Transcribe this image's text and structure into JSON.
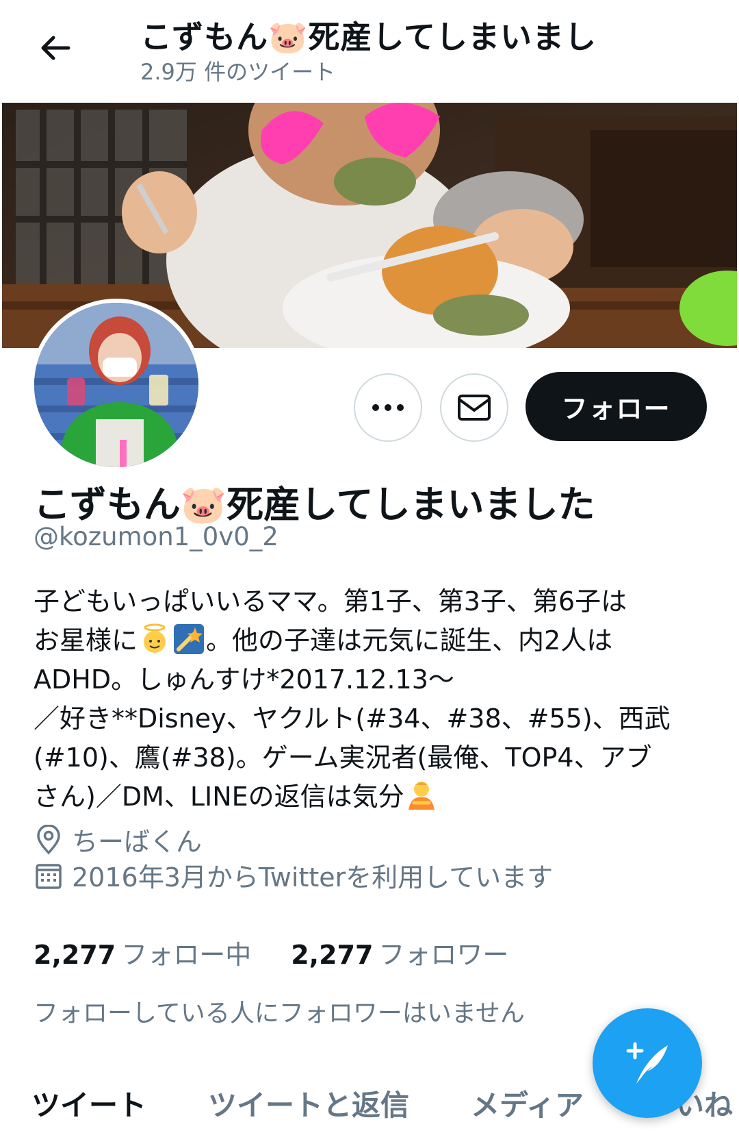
{
  "header": {
    "title": "こずもん🐷死産してしまいまし",
    "tweet_count": "2.9万 件のツイート"
  },
  "profile": {
    "display_name": "こずもん🐷死産してしまいました",
    "handle": "@kozumon1_0v0_2",
    "bio": {
      "line1": "子どもいっぱいいるママ。第1子、第3子、第6子は",
      "line2_a": "お星様に",
      "line2_b": "。他の子達は元気に誕生、内2人は",
      "line3": "ADHD。しゅんすけ*2017.12.13〜",
      "line4": "／好き**Disney、ヤクルト(#34、#38、#55)、西武",
      "line5": "(#10)、鷹(#38)。ゲーム実況者(最俺、TOP4、アブ",
      "line6": "さん)／DM、LINEの返信は気分"
    },
    "location": "ちーばくん",
    "joined": "2016年3月からTwitterを利用しています",
    "following_count": "2,277",
    "following_label": "フォロー中",
    "followers_count": "2,277",
    "followers_label": "フォロワー",
    "mutual_note": "フォローしている人にフォロワーはいません"
  },
  "actions": {
    "follow_label": "フォロー"
  },
  "tabs": [
    "ツイート",
    "ツイートと返信",
    "メディア",
    "いいね"
  ],
  "icons": {
    "back": "arrow-left-icon",
    "more": "more-horizontal-icon",
    "dm": "envelope-icon",
    "location": "location-pin-icon",
    "calendar": "calendar-icon",
    "compose": "compose-tweet-icon"
  },
  "colors": {
    "accent": "#1da1f2",
    "follow_button": "#0f1419",
    "secondary_text": "#657786"
  }
}
